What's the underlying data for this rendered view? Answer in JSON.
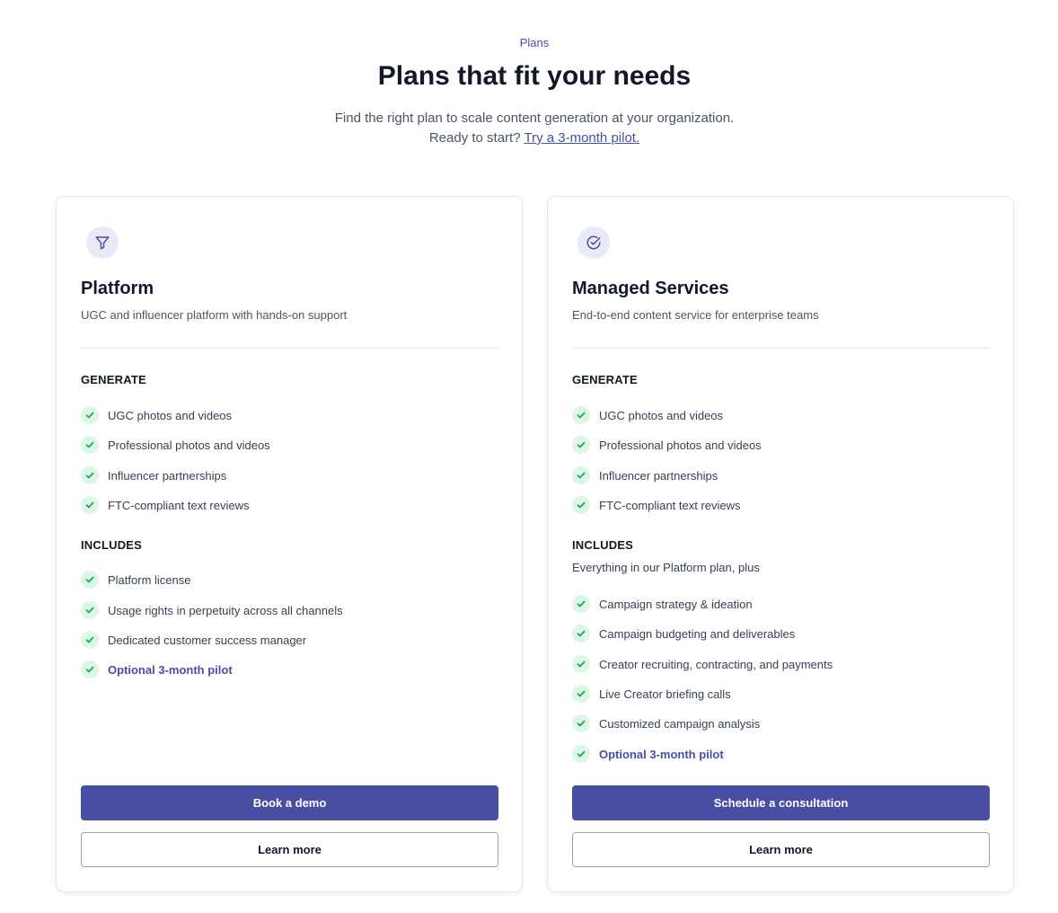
{
  "header": {
    "eyebrow": "Plans",
    "title": "Plans that fit your needs",
    "subtitle_line1": "Find the right plan to scale content generation at your organization.",
    "subtitle_line2_prefix": "Ready to start?",
    "pilot_link": "Try a 3-month pilot."
  },
  "colors": {
    "accent": "#4a4ea3",
    "check_bg": "#dcf7e6",
    "check_color": "#22a35a",
    "icon_bg": "#e9eaf7"
  },
  "plans": [
    {
      "icon": "filter-funnel-icon",
      "name": "Platform",
      "description": "UGC and influencer platform with hands-on support",
      "generate_title": "GENERATE",
      "generate": [
        "UGC photos and videos",
        "Professional photos and videos",
        "Influencer partnerships",
        "FTC-compliant text reviews"
      ],
      "includes_title": "INCLUDES",
      "includes": [
        "Platform license",
        "Usage rights in perpetuity across all channels",
        "Dedicated customer success manager",
        "Optional 3-month pilot"
      ],
      "primary_button": "Book a demo",
      "secondary_button": "Learn more"
    },
    {
      "icon": "circle-check-icon",
      "name": "Managed Services",
      "description": "End-to-end content service for enterprise teams",
      "generate_title": "GENERATE",
      "generate": [
        "UGC photos and videos",
        "Professional photos and videos",
        "Influencer partnerships",
        "FTC-compliant text reviews"
      ],
      "includes_title": "INCLUDES",
      "includes_note": "Everything in our Platform plan, plus",
      "includes": [
        "Campaign strategy & ideation",
        "Campaign budgeting and deliverables",
        "Creator recruiting, contracting, and payments",
        "Live Creator briefing calls",
        "Customized campaign analysis",
        "Optional 3-month pilot"
      ],
      "primary_button": "Schedule a consultation",
      "secondary_button": "Learn more"
    }
  ]
}
